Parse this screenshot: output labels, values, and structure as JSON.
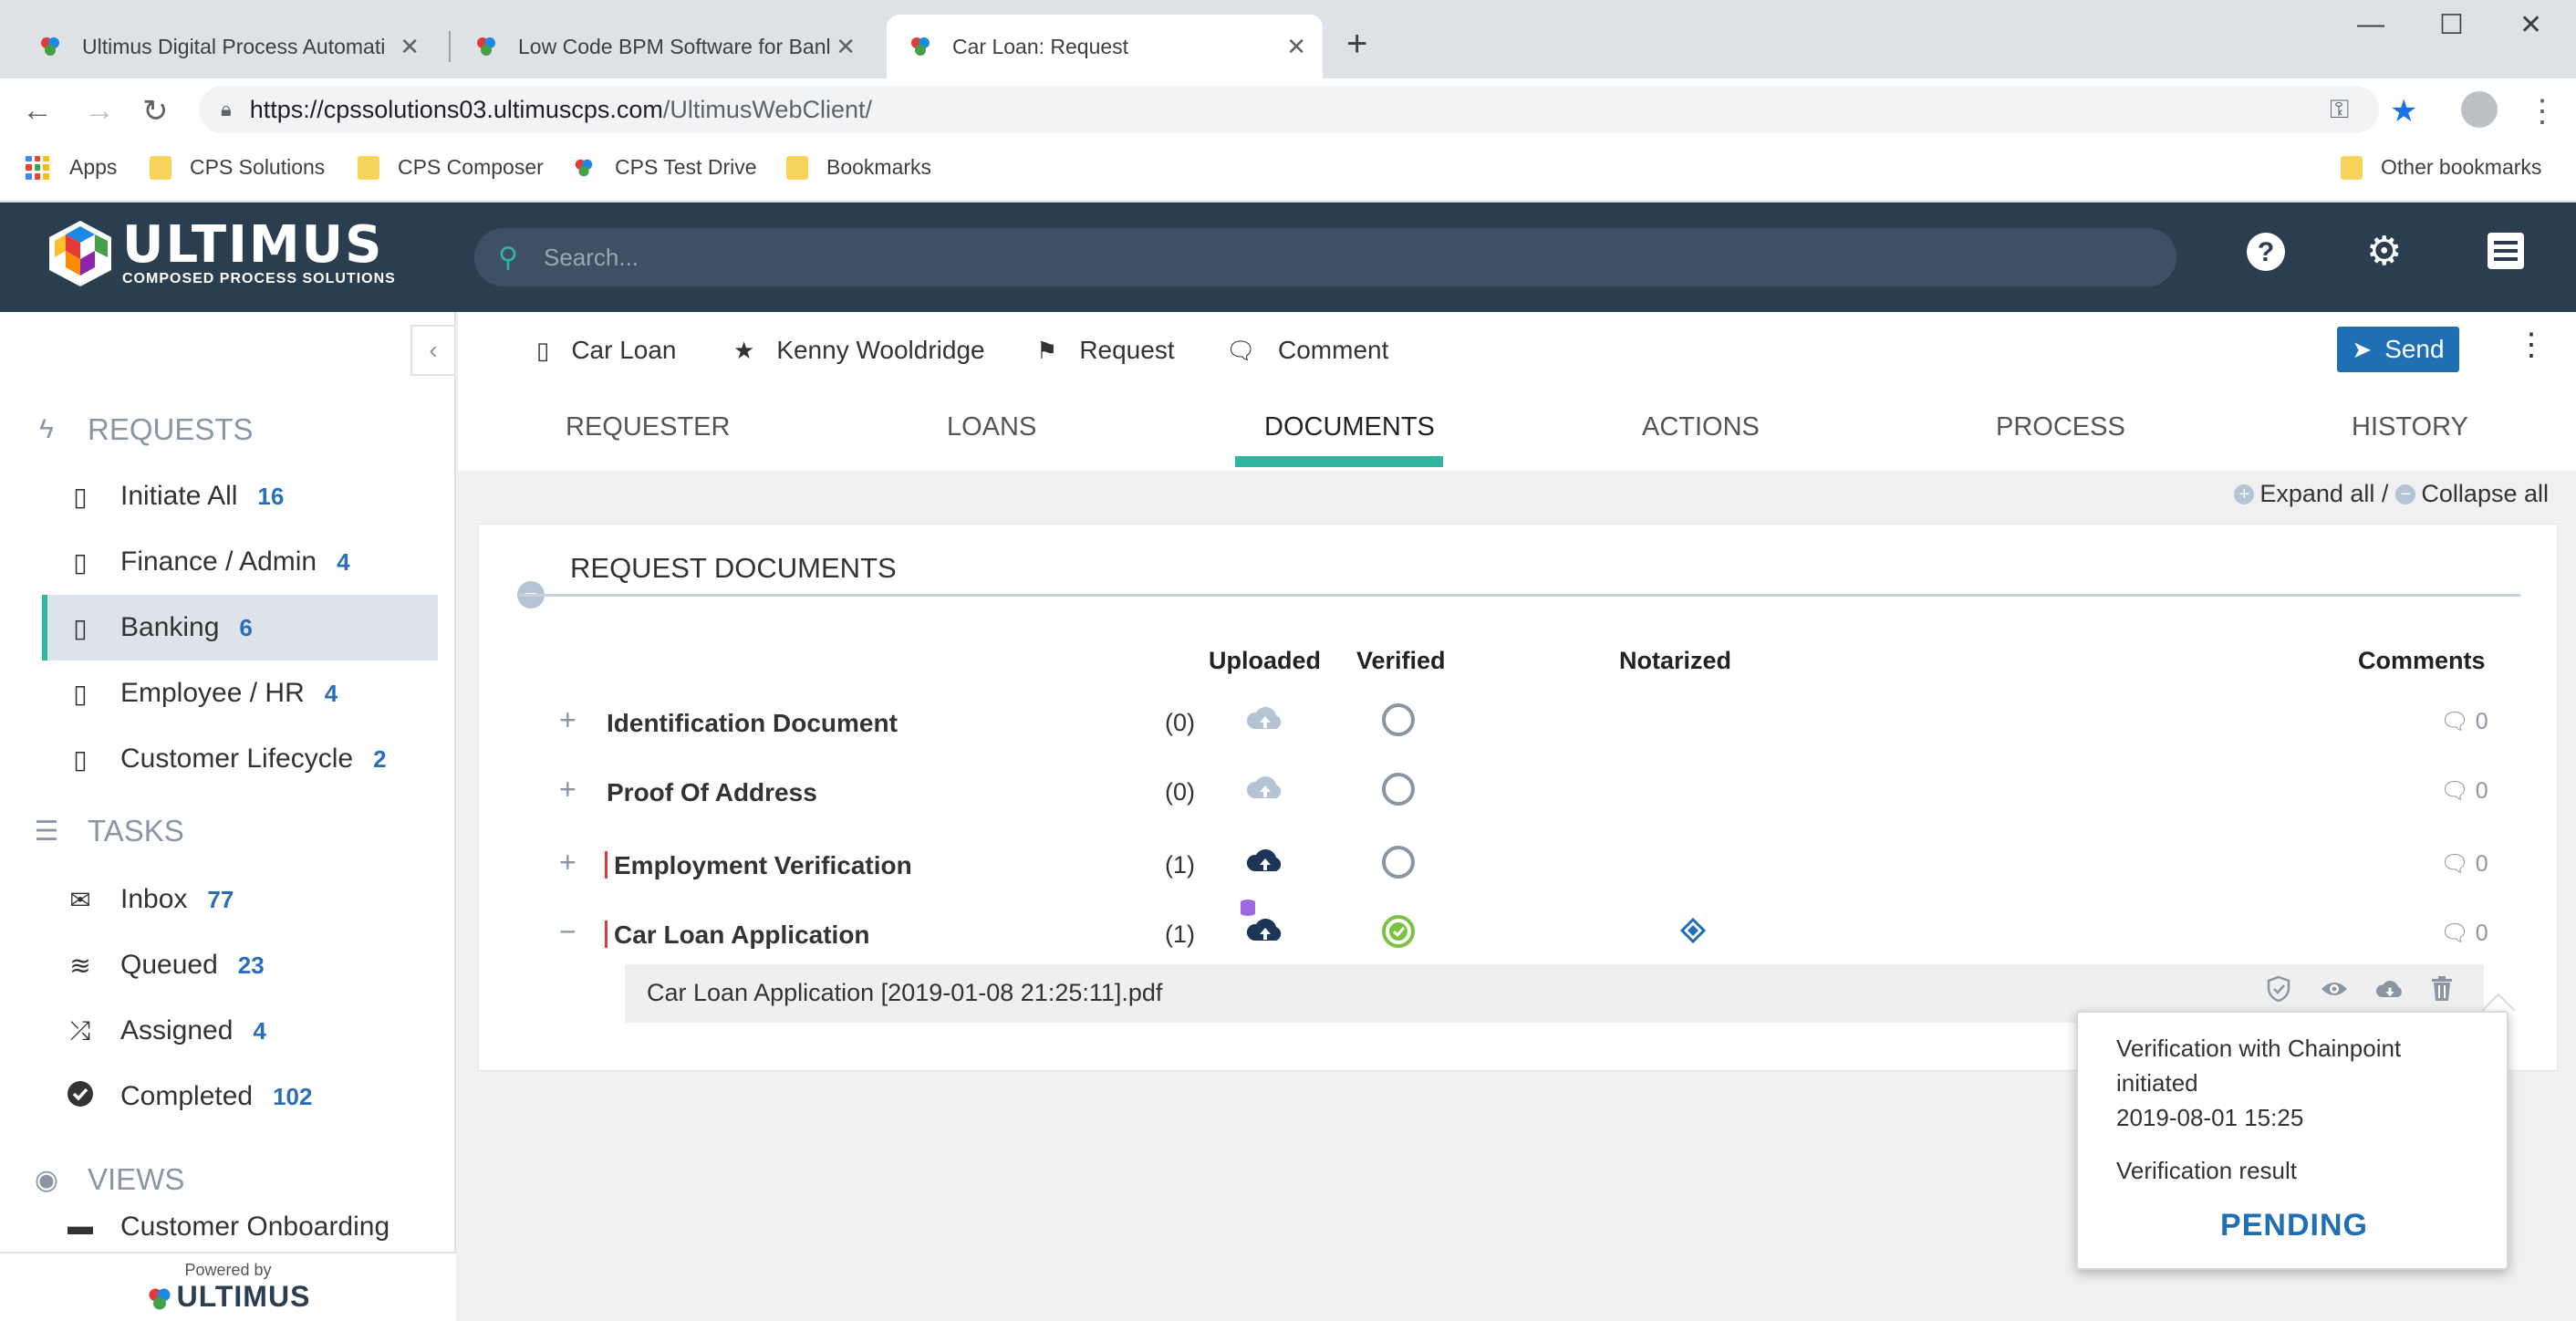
{
  "browser": {
    "tabs": [
      {
        "title": "Ultimus Digital Process Automati"
      },
      {
        "title": "Low Code BPM Software for Banl"
      },
      {
        "title": "Car Loan: Request"
      }
    ],
    "url_host": "https://cpssolutions03.ultimuscps.com",
    "url_path": "/UltimusWebClient/",
    "bookmarks": [
      "Apps",
      "CPS Solutions",
      "CPS Composer",
      "CPS Test Drive",
      "Bookmarks"
    ],
    "other_bookmarks": "Other bookmarks"
  },
  "app": {
    "logo_text": "ULTIMUS",
    "logo_sub": "COMPOSED PROCESS SOLUTIONS",
    "search_placeholder": "Search..."
  },
  "sidebar": {
    "requests_header": "REQUESTS",
    "requests": [
      {
        "label": "Initiate All",
        "count": "16"
      },
      {
        "label": "Finance / Admin",
        "count": "4"
      },
      {
        "label": "Banking",
        "count": "6"
      },
      {
        "label": "Employee / HR",
        "count": "4"
      },
      {
        "label": "Customer Lifecycle",
        "count": "2"
      }
    ],
    "tasks_header": "TASKS",
    "tasks": [
      {
        "label": "Inbox",
        "count": "77"
      },
      {
        "label": "Queued",
        "count": "23"
      },
      {
        "label": "Assigned",
        "count": "4"
      },
      {
        "label": "Completed",
        "count": "102"
      }
    ],
    "views_header": "VIEWS",
    "views_first": "Customer Onboarding",
    "powered_by": "Powered by",
    "powered_logo": "ULTIMUS"
  },
  "header": {
    "process": "Car Loan",
    "user": "Kenny Wooldridge",
    "step": "Request",
    "comment": "Comment",
    "send": "Send"
  },
  "tabs": [
    "REQUESTER",
    "LOANS",
    "DOCUMENTS",
    "ACTIONS",
    "PROCESS",
    "HISTORY"
  ],
  "expand_all": "Expand all /",
  "collapse_all": "Collapse all",
  "documents": {
    "title": "REQUEST DOCUMENTS",
    "columns": {
      "uploaded": "Uploaded",
      "verified": "Verified",
      "notarized": "Notarized",
      "comments": "Comments"
    },
    "rows": [
      {
        "name": "Identification Document",
        "count": "(0)",
        "comments": "0"
      },
      {
        "name": "Proof Of Address",
        "count": "(0)",
        "comments": "0"
      },
      {
        "name": "Employment Verification",
        "count": "(1)",
        "comments": "0"
      },
      {
        "name": "Car Loan Application",
        "count": "(1)",
        "comments": "0"
      }
    ],
    "file_name": "Car Loan Application [2019-01-08 21:25:11].pdf"
  },
  "popup": {
    "line1": "Verification with Chainpoint",
    "line2": "initiated",
    "date": "2019-08-01 15:25",
    "result_label": "Verification result",
    "result_value": "PENDING"
  }
}
